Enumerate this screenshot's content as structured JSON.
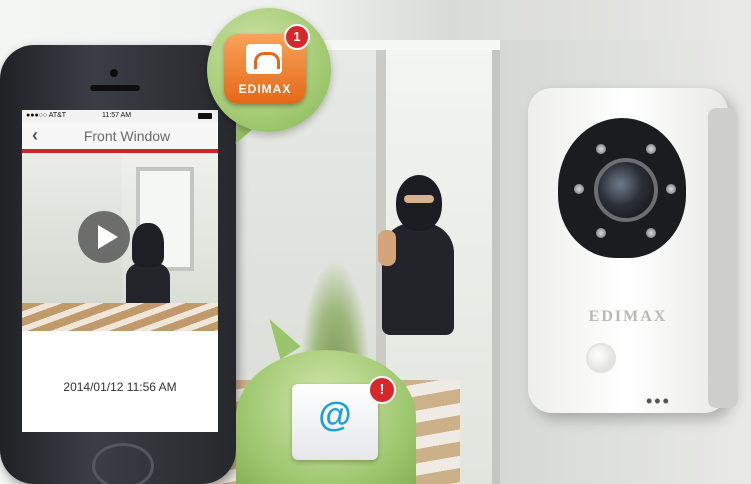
{
  "phone_screen": {
    "status": {
      "carrier": "●●●○○ AT&T",
      "time": "11:57 AM"
    },
    "nav": {
      "back_icon": "chevron-left-icon",
      "title": "Front Window"
    },
    "video": {
      "play_icon": "play-icon"
    },
    "timestamp": "2014/01/12  11:56 AM",
    "accent_color": "#d2232a"
  },
  "notifications": {
    "app": {
      "name": "EDIMAX",
      "badge_count": "1",
      "icon": "home-wifi-icon"
    },
    "email": {
      "symbol": "@",
      "badge": "!",
      "icon": "envelope-icon"
    }
  },
  "camera": {
    "brand": "EDIMAX"
  }
}
